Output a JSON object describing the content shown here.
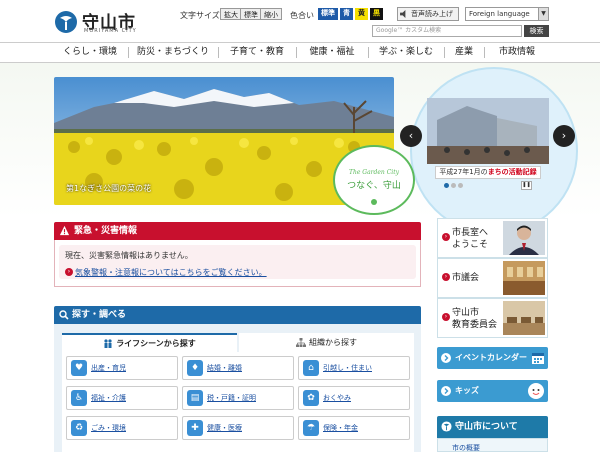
{
  "header": {
    "city_name": "守山市",
    "city_name_en": "MORIYAMA CITY",
    "font_size_label": "文字サイズ",
    "font_size_buttons": [
      "拡大",
      "標準",
      "縮小"
    ],
    "color_label": "色合い",
    "color_buttons": [
      "標準",
      "青",
      "黄",
      "黒"
    ],
    "speech_button": "音声読み上げ",
    "language_select": "Foreign language",
    "search_placeholder": "Google™ カスタム検索",
    "search_button": "検索"
  },
  "nav": {
    "items": [
      "くらし・環境",
      "防災・まちづくり",
      "子育て・教育",
      "健康・福祉",
      "学ぶ・楽しむ",
      "産業",
      "市政情報"
    ]
  },
  "hero": {
    "main_caption": "第1なぎさ公園の菜の花",
    "garden_badge_en": "The Garden City",
    "garden_badge_jp": "つなぐ、守山",
    "slide_caption_prefix": "平成27年1月の",
    "slide_caption_highlight": "まちの活動記録",
    "prev_arrow": "‹",
    "next_arrow": "›",
    "pause_icon": "❚❚"
  },
  "emergency": {
    "title": "緊急・災害情報",
    "status_text": "現在、災害緊急情報はありません。",
    "link_text": "気象警報・注意報についてはこちらをご覧ください。"
  },
  "search_section": {
    "title": "探す・調べる",
    "tabs": [
      "ライフシーンから探す",
      "組織から探す"
    ],
    "categories": [
      {
        "label": "出産・育児",
        "icon": "baby-icon",
        "glyph": "♥"
      },
      {
        "label": "結婚・離婚",
        "icon": "rings-icon",
        "glyph": "♦"
      },
      {
        "label": "引越し・住まい",
        "icon": "house-icon",
        "glyph": "⌂"
      },
      {
        "label": "福祉・介護",
        "icon": "wheelchair-icon",
        "glyph": "♿"
      },
      {
        "label": "税・戸籍・証明",
        "icon": "document-icon",
        "glyph": "▤"
      },
      {
        "label": "おくやみ",
        "icon": "flower-icon",
        "glyph": "✿"
      },
      {
        "label": "ごみ・環境",
        "icon": "trash-icon",
        "glyph": "♻"
      },
      {
        "label": "健康・医療",
        "icon": "cross-icon",
        "glyph": "✚"
      },
      {
        "label": "保険・年金",
        "icon": "insurance-icon",
        "glyph": "☂"
      }
    ]
  },
  "sidebar": {
    "cards": [
      {
        "label_line1": "市長室へ",
        "label_line2": "ようこそ"
      },
      {
        "label_line1": "市議会",
        "label_line2": ""
      },
      {
        "label_line1": "守山市",
        "label_line2": "教育委員会"
      }
    ],
    "event_calendar": "イベントカレンダー",
    "kids": "キッズ",
    "about_title": "守山市について",
    "about_item": "市の概要"
  },
  "colors": {
    "accent_red": "#c8102e",
    "accent_blue": "#1e6aa8",
    "garden_green": "#5cba5c",
    "side_blue": "#3b9bd1"
  }
}
